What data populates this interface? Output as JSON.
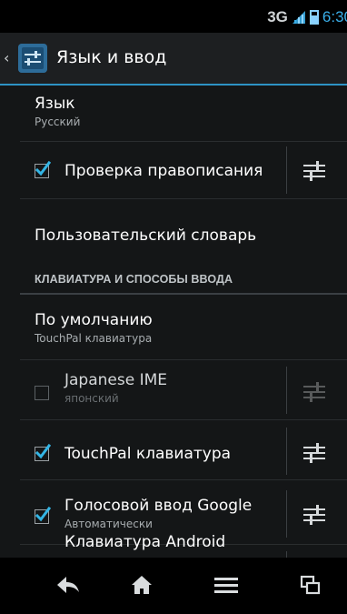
{
  "status_bar": {
    "network": "3G",
    "time": "6:30"
  },
  "action_bar": {
    "title": "Язык и ввод"
  },
  "prefs": {
    "language": {
      "title": "Язык",
      "summary": "Русский"
    },
    "spellcheck": {
      "title": "Проверка правописания",
      "checked": true
    },
    "user_dictionary": {
      "title": "Пользовательский словарь"
    }
  },
  "section": {
    "title": "КЛАВИАТУРА И СПОСОБЫ ВВОДА"
  },
  "default_ime": {
    "title": "По умолчанию",
    "summary": "TouchPal клавиатура"
  },
  "input_methods": [
    {
      "title": "Japanese IME",
      "summary": "японский",
      "checked": false,
      "enabled": false
    },
    {
      "title": "TouchPal клавиатура",
      "summary": "",
      "checked": true,
      "enabled": true
    },
    {
      "title": "Голосовой ввод Google",
      "summary": "Автоматически",
      "checked": true,
      "enabled": true
    },
    {
      "title": "Клавиатура Android",
      "summary": "",
      "checked": true,
      "enabled": true
    }
  ],
  "icons": {
    "back": "back-icon",
    "home": "home-icon",
    "menu": "menu-icon",
    "recents": "recent-apps-icon",
    "settings": "sliders-icon"
  },
  "colors": {
    "accent": "#33b5e5",
    "divider": "#2e93c4"
  }
}
